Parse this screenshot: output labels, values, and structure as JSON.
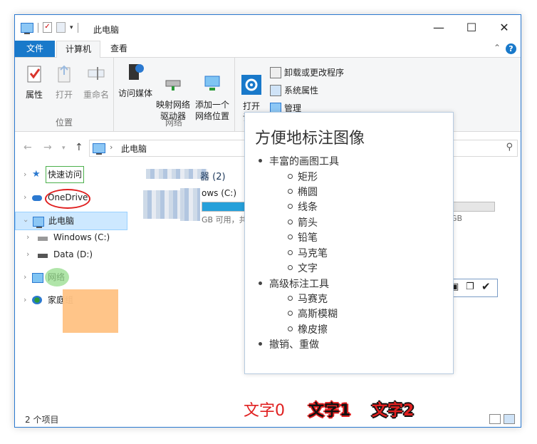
{
  "window": {
    "title": "此电脑",
    "controls": {
      "minimize": "—",
      "maximize": "☐",
      "close": "✕"
    }
  },
  "ribbon": {
    "tabs": [
      {
        "label": "文件"
      },
      {
        "label": "计算机"
      },
      {
        "label": "查看"
      }
    ],
    "groups": [
      {
        "label": "位置",
        "buttons": [
          "属性",
          "打开",
          "重命名"
        ]
      },
      {
        "label": "网络",
        "buttons": [
          "访问媒体",
          "映射网络\n驱动器",
          "添加一个\n网络位置"
        ]
      },
      {
        "label": "",
        "buttons": [
          "打开\n设置"
        ]
      }
    ],
    "system_links": [
      "卸载或更改程序",
      "系统属性",
      "管理"
    ]
  },
  "address": {
    "path": "此电脑"
  },
  "nav": {
    "items": [
      {
        "label": "快速访问"
      },
      {
        "label": "OneDrive"
      },
      {
        "label": "此电脑"
      },
      {
        "label": "Windows (C:)"
      },
      {
        "label": "Data (D:)"
      },
      {
        "label": "网络"
      },
      {
        "label": "家庭组"
      }
    ]
  },
  "main": {
    "group_header": "器 (2)",
    "drive_name": "ows (C:)",
    "drive_sub": "GB 可用，共",
    "drive_sub_right": "GB",
    "drive_usage_fraction": 0.2
  },
  "status": {
    "count": "2 个项目"
  },
  "popup": {
    "title": "方便地标注图像",
    "list": [
      {
        "label": "丰富的画图工具",
        "children": [
          "矩形",
          "椭圆",
          "线条",
          "箭头",
          "铅笔",
          "马克笔",
          "文字"
        ]
      },
      {
        "label": "高级标注工具",
        "children": [
          "马赛克",
          "高斯模糊",
          "橡皮擦"
        ]
      },
      {
        "label": "撤销、重做",
        "children": []
      }
    ]
  },
  "annotations": {
    "text_samples": [
      "文字0",
      "文字1",
      "文字2"
    ],
    "colors": {
      "red": "#e02020",
      "green": "#4cb04c",
      "marker": "#96dc8c",
      "mosaic": "#ffc283"
    }
  }
}
